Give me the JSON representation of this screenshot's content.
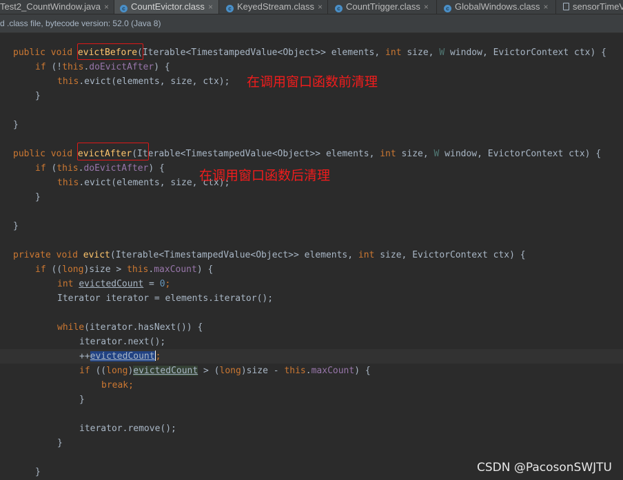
{
  "tabs": [
    {
      "label": "Test2_CountWindow.java",
      "close": "×",
      "icon": "java-file-icon"
    },
    {
      "label": "CountEvictor.class",
      "close": "×",
      "icon": "class-file-icon"
    },
    {
      "label": "KeyedStream.class",
      "close": "×",
      "icon": "class-file-icon"
    },
    {
      "label": "CountTrigger.class",
      "close": "×",
      "icon": "class-file-icon"
    },
    {
      "label": "GlobalWindows.class",
      "close": "×",
      "icon": "class-file-icon"
    },
    {
      "label": "sensorTimeV",
      "icon": "file-icon"
    }
  ],
  "infobar": {
    "text": "d .class file, bytecode version: 52.0 (Java 8)"
  },
  "annotations": {
    "before": "在调用窗口函数前清理",
    "after": "在调用窗口函数后清理"
  },
  "watermark": "CSDN @PacosonSWJTU",
  "colors": {
    "background": "#2b2b2b",
    "keyword": "#cc7832",
    "field": "#9876aa",
    "number": "#6897bb",
    "method": "#ffc66d",
    "annotation": "#f01c1c"
  },
  "code": {
    "l1": {
      "t1": "public void ",
      "m": "evictBefore",
      "t2": "(Iterable<TimestampedValue<Object>> elements, ",
      "k1": "int",
      "t3": " size, ",
      "w": "W",
      "t4": " window, EvictorContext ctx) {"
    },
    "l2": {
      "k": "if",
      "t1": " (!",
      "th": "this",
      "t2": ".",
      "f": "doEvictAfter",
      "t3": ") {"
    },
    "l3": {
      "th": "this",
      "t": ".evict(elements, size, ctx);"
    },
    "l4": {
      "t": "}"
    },
    "l5": {
      "t": "}"
    },
    "l6": {
      "t1": "public void ",
      "m": "evictAfter",
      "t2": "(Iterable<TimestampedValue<Object>> elements, ",
      "k1": "int",
      "t3": " size, ",
      "w": "W",
      "t4": " window, EvictorContext ctx) {"
    },
    "l7": {
      "k": "if",
      "t1": " (",
      "th": "this",
      "t2": ".",
      "f": "doEvictAfter",
      "t3": ") {"
    },
    "l8": {
      "th": "this",
      "t": ".evict(elements, size, ctx);"
    },
    "l9": {
      "t": "}"
    },
    "l10": {
      "t": "}"
    },
    "l11": {
      "t1": "private void ",
      "m": "evict",
      "t2": "(Iterable<TimestampedValue<Object>> elements, ",
      "k1": "int",
      "t3": " size, EvictorContext ctx) {"
    },
    "l12": {
      "k": "if",
      "t1": " ((",
      "k2": "long",
      "t2": ")size > ",
      "th": "this",
      "t3": ".",
      "f": "maxCount",
      "t4": ") {"
    },
    "l13": {
      "k": "int",
      "t1": " ",
      "v": "evictedCount",
      "t2": " = ",
      "n": "0",
      "t3": ";"
    },
    "l14": {
      "t": "Iterator iterator = elements.iterator();"
    },
    "l15": {
      "k": "while",
      "t": "(iterator.hasNext()) {"
    },
    "l16": {
      "t": "iterator.next();"
    },
    "l17": {
      "t1": "++",
      "v": "evictedCount",
      "t2": ";"
    },
    "l18": {
      "k": "if",
      "t1": " ((",
      "k2": "long",
      "t2": ")",
      "v": "evictedCount",
      "t3": " > (",
      "k3": "long",
      "t4": ")size - ",
      "th": "this",
      "t5": ".",
      "f": "maxCount",
      "t6": ") {"
    },
    "l19": {
      "k": "break",
      "t": ";"
    },
    "l20": {
      "t": "}"
    },
    "l21": {
      "t": "iterator.remove();"
    },
    "l22": {
      "t": "}"
    },
    "l23": {
      "t": "}"
    }
  }
}
